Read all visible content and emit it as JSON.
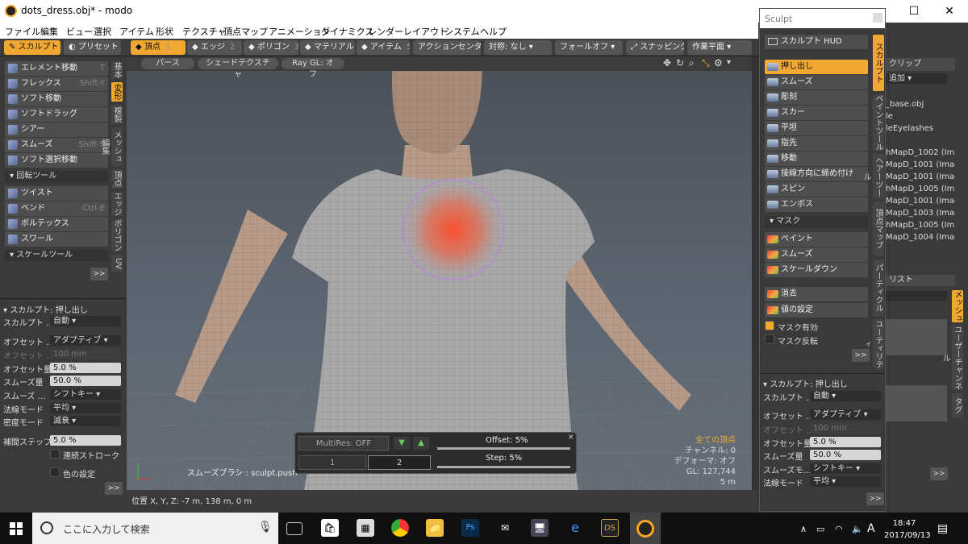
{
  "window": {
    "title": "dots_dress.obj* - modo",
    "minimize": "—",
    "maximize": "☐",
    "close": "✕"
  },
  "menu": [
    "ファイル",
    "編集",
    "ビュー",
    "選択",
    "アイテム",
    "形状",
    "テクスチャ",
    "頂点マップ",
    "アニメーション",
    "ダイナミクス",
    "レンダー",
    "レイアウト",
    "システム",
    "ヘルプ"
  ],
  "toolbar": {
    "sculpt": "スカルプト",
    "preset": "プリセット",
    "modes": [
      {
        "label": "頂点",
        "key": "1"
      },
      {
        "label": "エッジ",
        "key": "2"
      },
      {
        "label": "ポリゴン",
        "key": "3"
      },
      {
        "label": "マテリアル",
        "key": "4"
      },
      {
        "label": "アイテム",
        "key": "5"
      }
    ],
    "action_center": "アクションセンター",
    "symmetry": "対称: なし",
    "falloff": "フォールオフ",
    "snapping": "スナッピング",
    "workplane": "作業平面"
  },
  "left": {
    "tools": [
      {
        "label": "エレメント移動",
        "key": "T"
      },
      {
        "label": "フレックス",
        "key": "Shift-Y"
      },
      {
        "label": "ソフト移動",
        "key": ""
      },
      {
        "label": "ソフトドラッグ",
        "key": ""
      },
      {
        "label": "シアー",
        "key": ""
      },
      {
        "label": "スムーズ",
        "key": "Shift-S"
      },
      {
        "label": "ソフト選択移動",
        "key": ""
      }
    ],
    "rotate_group": "回転ツール",
    "rotate_tools": [
      {
        "label": "ツイスト",
        "key": ""
      },
      {
        "label": "ベンド",
        "key": "Ctrl-E"
      },
      {
        "label": "ボルテックス",
        "key": ""
      },
      {
        "label": "スワール",
        "key": ""
      }
    ],
    "scale_group": "スケールツール",
    "more": ">>",
    "vtabs": [
      "基本",
      "変形",
      "複製",
      "メッシュ編集",
      "頂点",
      "エッジ",
      "ポリゴン",
      "UV"
    ],
    "props": {
      "header": "スカルプト: 押し出し",
      "rows": [
        {
          "label": "スカルプト …",
          "value": "自動"
        },
        {
          "label": "オフセット …",
          "value": "アダプティブ"
        },
        {
          "label": "オフセット …",
          "value": "100 mm"
        },
        {
          "label": "オフセット量",
          "value": "5.0 %"
        },
        {
          "label": "スムーズ量",
          "value": "50.0 %"
        },
        {
          "label": "スムーズ …",
          "value": "シフトキー"
        },
        {
          "label": "法線モード",
          "value": "平均"
        },
        {
          "label": "密度モード",
          "value": "滅衰"
        },
        {
          "label": "補間ステップ",
          "value": "5.0 %"
        }
      ],
      "stroke": "連続ストローク",
      "color": "色の設定"
    }
  },
  "viewport": {
    "tabs": [
      "パース",
      "シェードテクスチャ",
      "Ray GL: オフ"
    ],
    "brush_label": "スムーズブラシ : sculpt.push",
    "stats": {
      "all": "全ての頂点",
      "channel": "チャンネル: 0",
      "deformer": "デフォーマ: オフ",
      "gl": "GL: 127,744",
      "dist": "5 m"
    },
    "multires": "MultiRes: OFF",
    "level1": "1",
    "level2": "2",
    "offset": "Offset:   5%",
    "step": "Step:   5%"
  },
  "status": {
    "position": "位置 X, Y, Z:   -7 m, 138 m, 0 m"
  },
  "sculpt_panel": {
    "title": "Sculpt",
    "hud": "スカルプト HUD",
    "tools": [
      "押し出し",
      "スムーズ",
      "彫刻",
      "スカー",
      "平坦",
      "指先",
      "移動",
      "接線方向に締め付け",
      "スピン",
      "エンボス"
    ],
    "mask_group": "マスク",
    "mask_tools": [
      "ペイント",
      "スムーズ",
      "スケールダウン"
    ],
    "other_tools": [
      "消去",
      "値の設定"
    ],
    "mask_on": "マスク有効",
    "mask_invert": "マスク反転",
    "vtabs": [
      "スカルプト",
      "ペイントツール",
      "ヘアーツール",
      "頂点マップ",
      "パーティクル",
      "ユーティリティ"
    ],
    "more": ">>",
    "props": {
      "header": "スカルプト: 押し出し",
      "rows": [
        {
          "label": "スカルプト …",
          "value": "自動"
        },
        {
          "label": "オフセット …",
          "value": "アダプティブ"
        },
        {
          "label": "オフセット …",
          "value": "100 mm"
        },
        {
          "label": "オフセット量",
          "value": "5.0 %"
        },
        {
          "label": "スムーズ量",
          "value": "50.0 %"
        },
        {
          "label": "スムーズモ…",
          "value": "シフトキー"
        },
        {
          "label": "法線モード",
          "value": "平均"
        }
      ]
    }
  },
  "far_right": {
    "tab": "クリップ",
    "add": "追加",
    "items": [
      "_base.obj",
      "le",
      "leEyelashes",
      "hMapD_1002 (Imag",
      "MapD_1001 (Image",
      "MapD_1001 (Image",
      "hMapD_1005 (Imag",
      "MapD_1001 (Image",
      "MapD_1003 (Image",
      "hMapD_1005 (Imag",
      "MapD_1004 (Image"
    ],
    "list_tab": "リスト",
    "vtabs": [
      "メッシュ",
      "ユーザーチャンネル",
      "タグ"
    ]
  },
  "taskbar": {
    "search": "ここに入力して検索",
    "time": "18:47",
    "date": "2017/09/13",
    "ime": "A"
  }
}
